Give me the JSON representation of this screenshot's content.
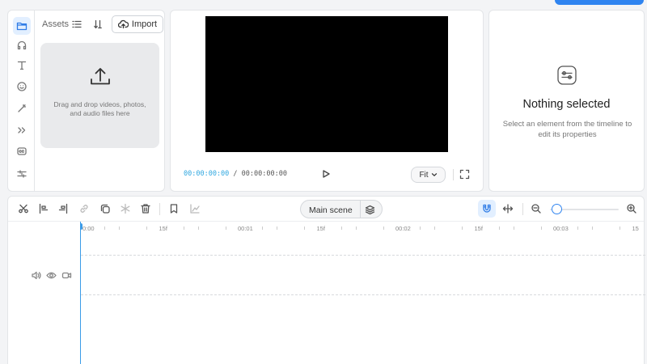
{
  "assets": {
    "tab_label": "Assets",
    "import_label": "Import",
    "drop_text": "Drag and drop videos, photos, and audio files here"
  },
  "preview": {
    "timecode_current": "00:00:00:00",
    "timecode_separator": " / ",
    "timecode_total": "00:00:00:00",
    "fit_label": "Fit"
  },
  "properties": {
    "title": "Nothing selected",
    "description": "Select an element from the timeline to edit its properties"
  },
  "timeline": {
    "scene_label": "Main scene",
    "ruler_labels": [
      {
        "text": "0:00",
        "pos": 0
      },
      {
        "text": "15f",
        "pos": 1
      },
      {
        "text": "00:01",
        "pos": 2
      },
      {
        "text": "15f",
        "pos": 3
      },
      {
        "text": "00:02",
        "pos": 4
      },
      {
        "text": "15f",
        "pos": 5
      },
      {
        "text": "00:03",
        "pos": 6
      },
      {
        "text": "15",
        "pos": 7
      }
    ],
    "zoom_level": 0.05
  },
  "colors": {
    "accent": "#2f84f0",
    "playhead": "#3b9be8",
    "timecode_current": "#2fa7e0"
  },
  "icons": {
    "rail": [
      "folder-icon",
      "headphones-icon",
      "text-icon",
      "emoji-icon",
      "magic-wand-icon",
      "transition-icon",
      "captions-icon",
      "adjust-icon"
    ]
  }
}
